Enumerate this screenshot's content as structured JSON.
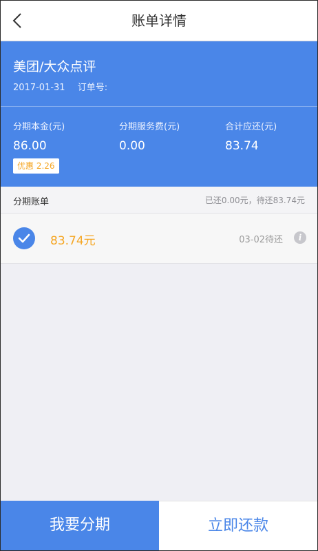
{
  "nav": {
    "title": "账单详情",
    "back_icon": "chevron-left-icon"
  },
  "header": {
    "merchant": "美团/大众点评",
    "date": "2017-01-31",
    "order_label": "订单号:",
    "principal_label": "分期本金(元)",
    "principal_value": "86.00",
    "service_fee_label": "分期服务费(元)",
    "service_fee_value": "0.00",
    "total_label": "合计应还(元)",
    "total_value": "83.74",
    "discount_badge": "优惠 2.26"
  },
  "bills": {
    "section_title": "分期账单",
    "summary": "已还0.00元，待还83.74元",
    "items": [
      {
        "amount": "83.74元",
        "due": "03-02待还",
        "checked": true,
        "check_icon": "checkmark-icon",
        "info_icon": "info-icon"
      }
    ]
  },
  "actions": {
    "installment_label": "我要分期",
    "repay_label": "立即还款"
  },
  "colors": {
    "primary": "#4a86e8",
    "accent": "#f5a623"
  }
}
